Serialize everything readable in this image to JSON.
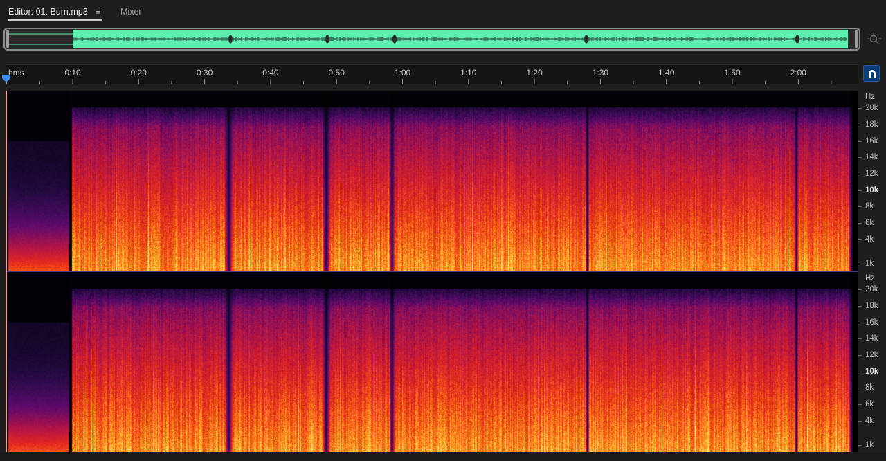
{
  "tabs": {
    "editor_label": "Editor: 01. Burn.mp3",
    "menu_icon": "≡",
    "mixer_label": "Mixer"
  },
  "ruler": {
    "labels": [
      "hms",
      "0:10",
      "0:20",
      "0:30",
      "0:40",
      "0:50",
      "1:00",
      "1:10",
      "1:20",
      "1:30",
      "1:40",
      "1:50",
      "2:00"
    ]
  },
  "hz_scale": {
    "unit": "Hz",
    "labels": [
      "20k",
      "18k",
      "16k",
      "14k",
      "12k",
      "10k",
      "8k",
      "6k",
      "4k",
      "1k"
    ],
    "bold_label": "10k"
  },
  "colors": {
    "waveform": "#5ef0b0",
    "accent_button": "#0b3d78",
    "playhead": "#3b8df0"
  },
  "icons": {
    "zoom": "zoom-navigator-icon",
    "snap": "snap-magnet-icon",
    "playhead": "playhead-icon"
  }
}
